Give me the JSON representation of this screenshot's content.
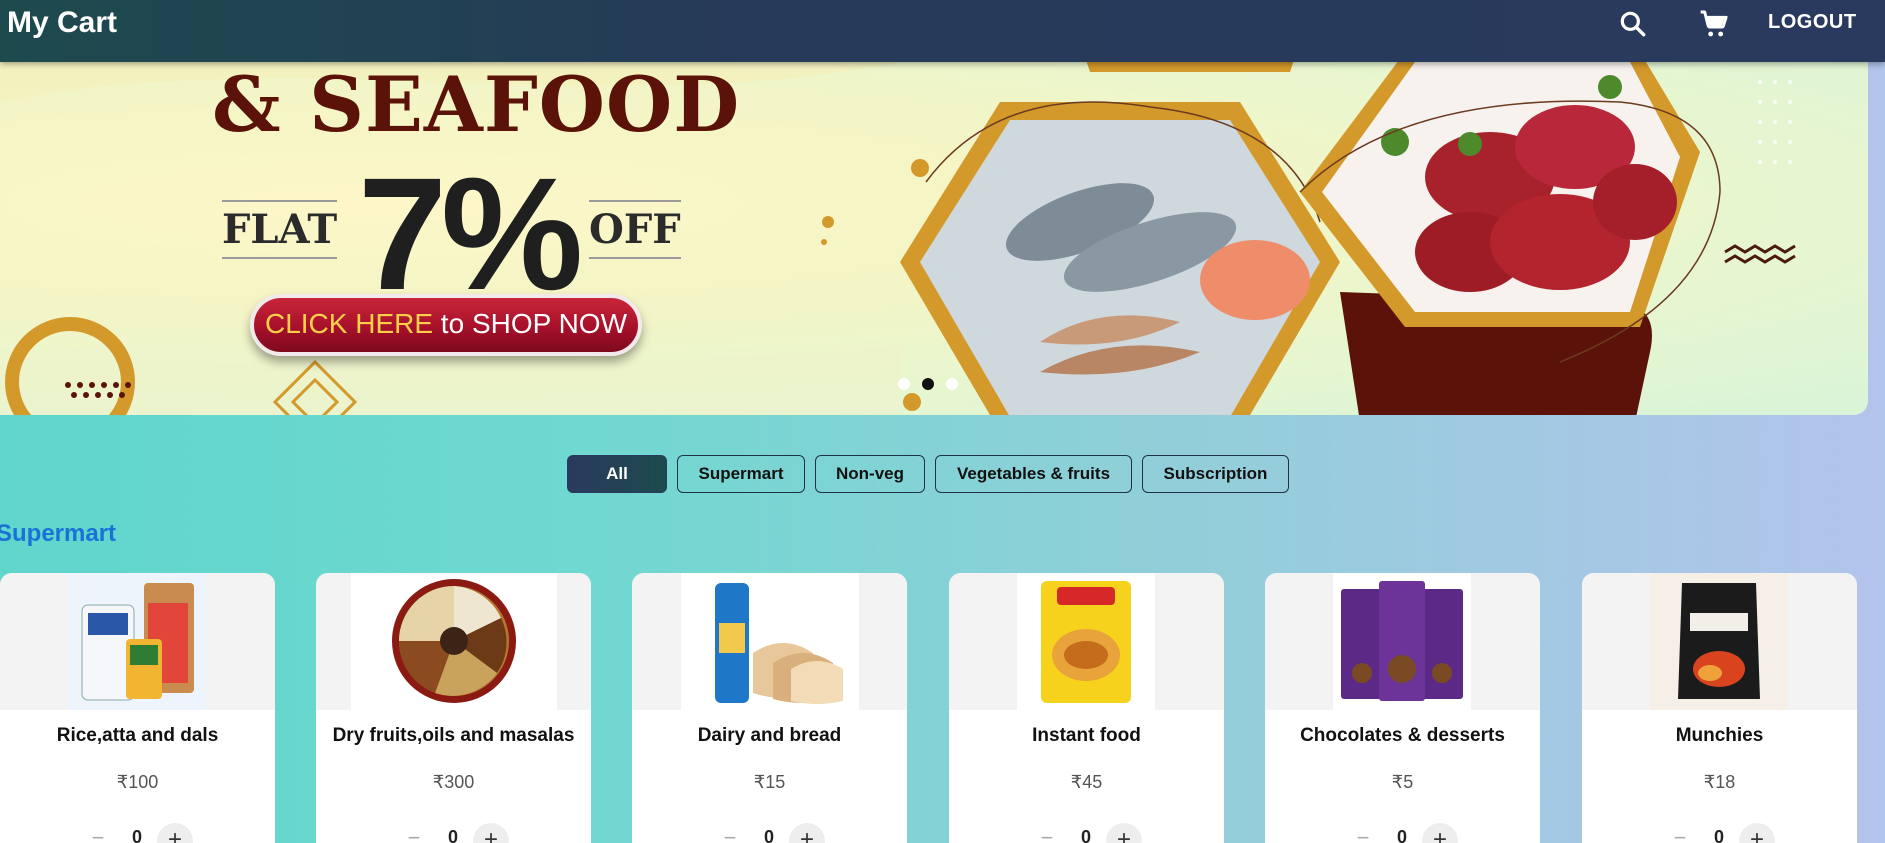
{
  "header": {
    "title": "My Cart",
    "search_icon": "search-icon",
    "cart_icon": "cart-icon",
    "logout_label": "LOGOUT"
  },
  "banner": {
    "headline": "& SEAFOOD",
    "flat": "FLAT",
    "percent": "7%",
    "off": "OFF",
    "cta_highlight": "CLICK HERE",
    "cta_rest": " to SHOP NOW",
    "slides": 3,
    "active_slide": 2
  },
  "filters": [
    {
      "label": "All",
      "active": true
    },
    {
      "label": "Supermart",
      "active": false
    },
    {
      "label": "Non-veg",
      "active": false
    },
    {
      "label": "Vegetables & fruits",
      "active": false
    },
    {
      "label": "Subscription",
      "active": false
    }
  ],
  "section": {
    "title": "Supermart"
  },
  "products": [
    {
      "name": "Rice,atta and dals",
      "price": "₹100",
      "qty": "0",
      "image": "rice-atta-dals-image"
    },
    {
      "name": "Dry fruits,oils and masalas",
      "price": "₹300",
      "qty": "0",
      "image": "dry-fruits-image"
    },
    {
      "name": "Dairy and bread",
      "price": "₹15",
      "qty": "0",
      "image": "bread-image"
    },
    {
      "name": "Instant food",
      "price": "₹45",
      "qty": "0",
      "image": "instant-noodles-image"
    },
    {
      "name": "Chocolates & desserts",
      "price": "₹5",
      "qty": "0",
      "image": "chocolates-image"
    },
    {
      "name": "Munchies",
      "price": "₹18",
      "qty": "0",
      "image": "chips-image"
    }
  ],
  "colors": {
    "header": "#263a59",
    "accent_blue": "#1a72d6",
    "banner_red": "#a6102a",
    "banner_gold": "#d4992b"
  }
}
